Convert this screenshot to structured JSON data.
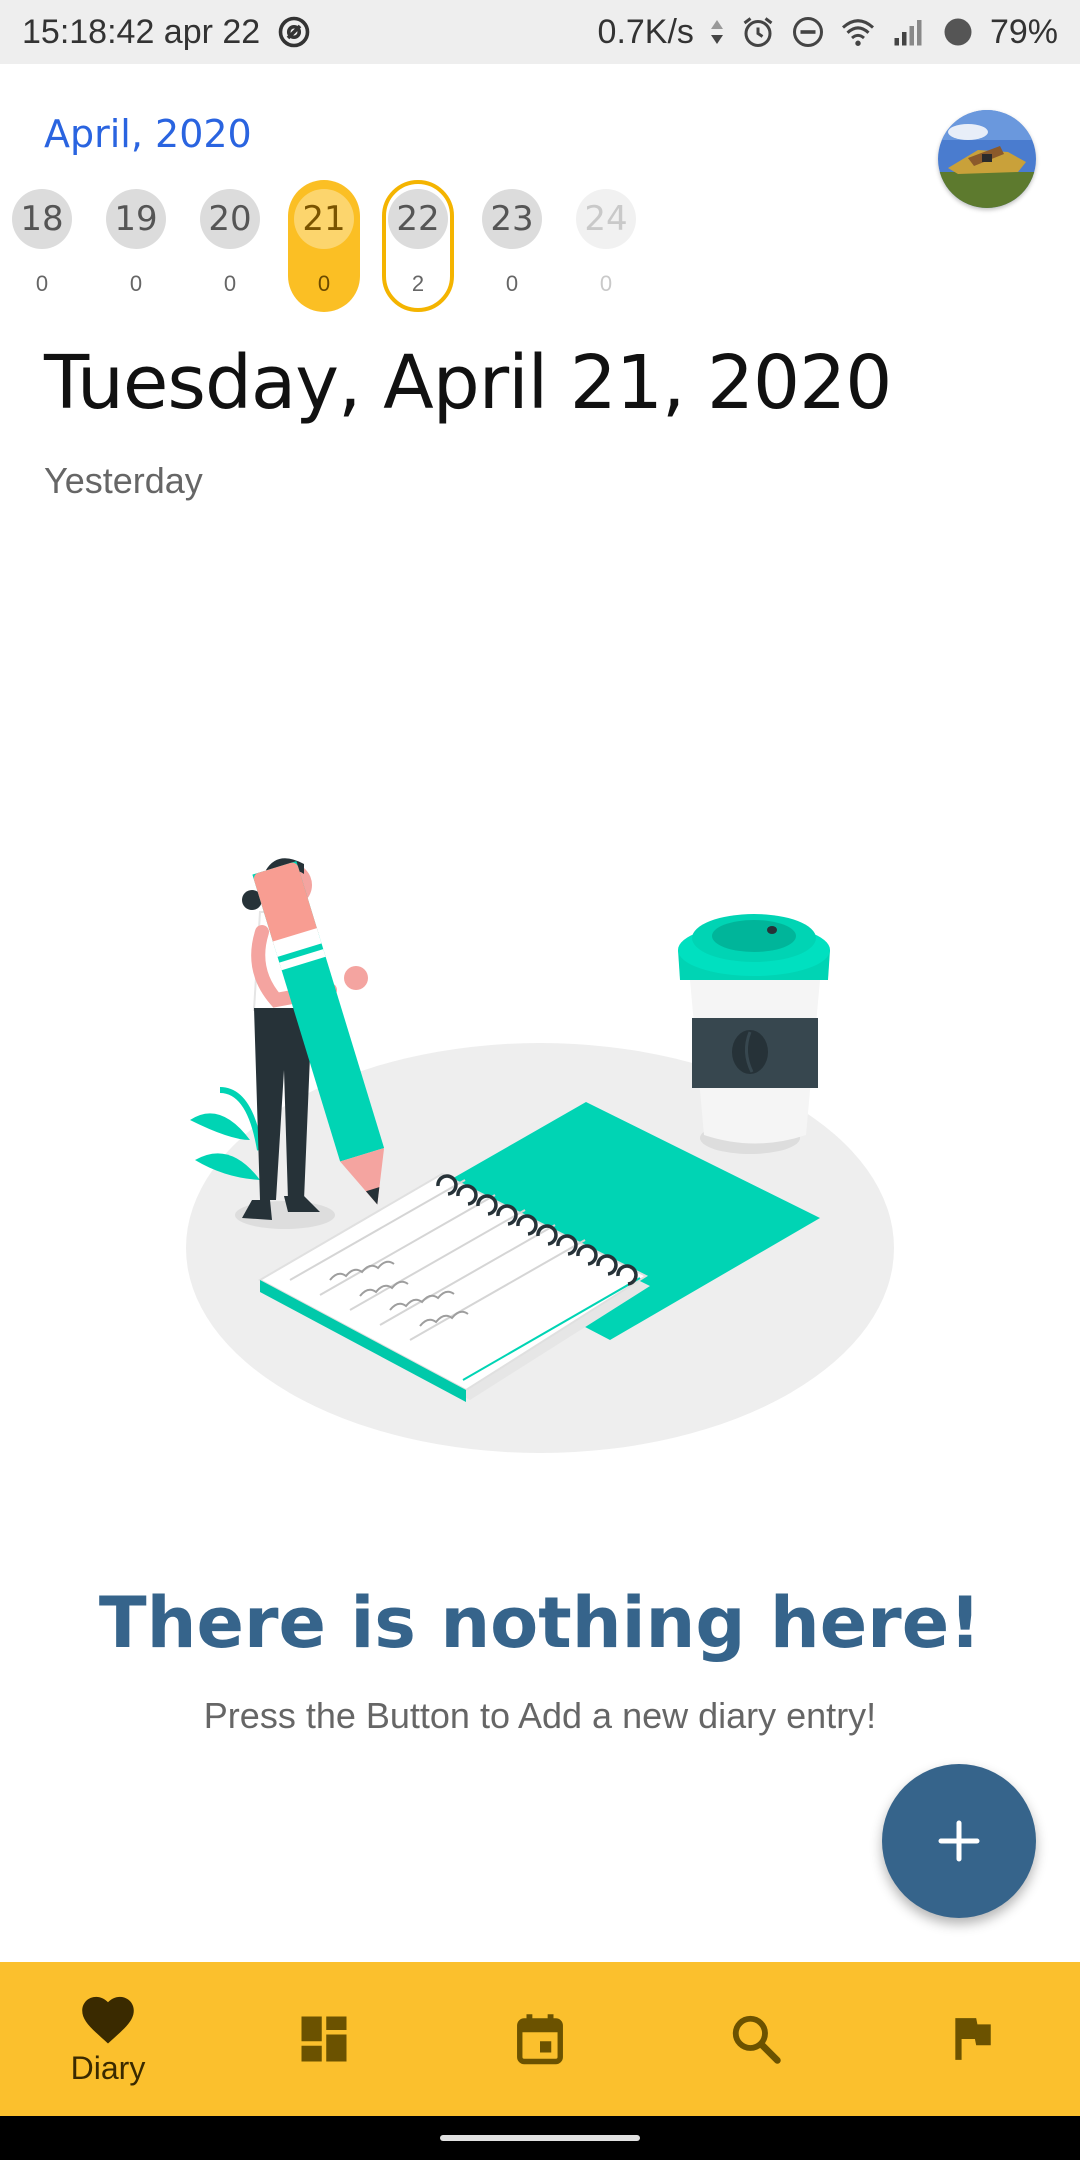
{
  "status_bar": {
    "time": "15:18:42 apr 22",
    "net_speed": "0.7K/s",
    "battery": "79%"
  },
  "header": {
    "month": "April, 2020"
  },
  "date_strip": [
    {
      "day": "18",
      "count": "0",
      "state": "normal"
    },
    {
      "day": "19",
      "count": "0",
      "state": "normal"
    },
    {
      "day": "20",
      "count": "0",
      "state": "normal"
    },
    {
      "day": "21",
      "count": "0",
      "state": "selected"
    },
    {
      "day": "22",
      "count": "2",
      "state": "today"
    },
    {
      "day": "23",
      "count": "0",
      "state": "normal"
    },
    {
      "day": "24",
      "count": "0",
      "state": "faded"
    }
  ],
  "main": {
    "date_title": "Tuesday, April 21, 2020",
    "relative_day": "Yesterday",
    "empty_title": "There is nothing here!",
    "empty_subtitle": "Press the Button to Add a new diary entry!"
  },
  "fab": {
    "icon": "plus-icon"
  },
  "bottom_nav": {
    "items": [
      {
        "icon": "heart-icon",
        "label": "Diary",
        "active": true
      },
      {
        "icon": "dashboard-icon",
        "label": "",
        "active": false
      },
      {
        "icon": "calendar-icon",
        "label": "",
        "active": false
      },
      {
        "icon": "search-icon",
        "label": "",
        "active": false
      },
      {
        "icon": "flag-icon",
        "label": "",
        "active": false
      }
    ]
  },
  "colors": {
    "accent_blue": "#2a64e0",
    "primary_dark": "#36648b",
    "nav_yellow": "#fbc02d",
    "selected_day": "#fbbf24",
    "teal": "#00d4b4"
  }
}
